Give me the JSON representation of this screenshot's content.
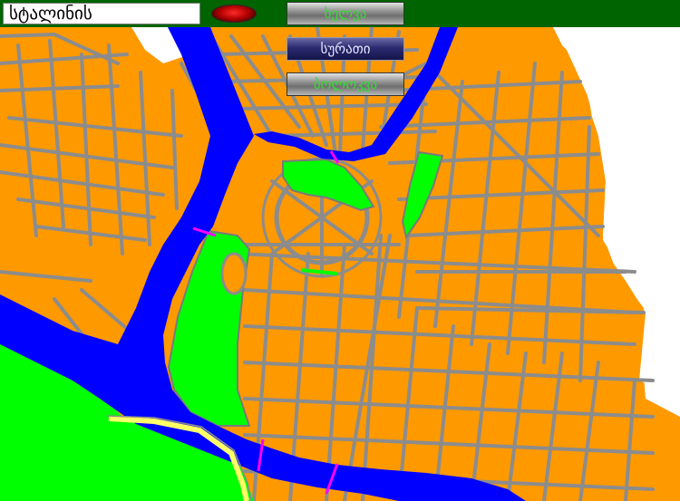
{
  "toolbar": {
    "search_value": "სტალინის",
    "button_1_label": "ხელვა",
    "button_2_label": "სურათი",
    "button_3_label": "ბოლოკვა"
  },
  "colors": {
    "toolbar_bg": "#006400",
    "land": "#ff9900",
    "streets": "#8c8c8c",
    "water": "#0000ff",
    "park": "#00ff00",
    "highlight_road": "#ffff66",
    "bridge": "#ff00ff",
    "background": "#ffffff"
  },
  "icons": {
    "status_light": "red-oval-indicator-icon"
  }
}
